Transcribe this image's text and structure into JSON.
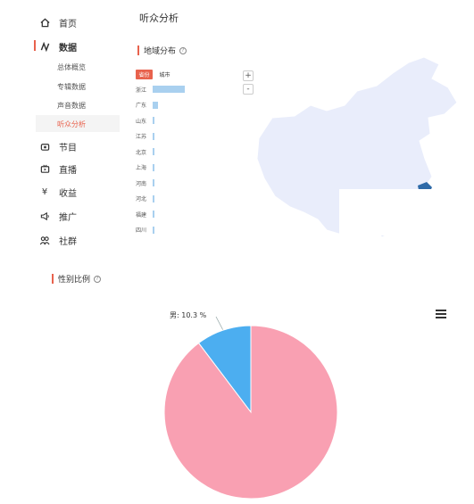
{
  "sidebar": {
    "items": [
      {
        "label": "首页",
        "icon": "home-icon"
      },
      {
        "label": "数据",
        "icon": "data-icon"
      },
      {
        "label": "节目",
        "icon": "program-icon"
      },
      {
        "label": "直播",
        "icon": "live-icon"
      },
      {
        "label": "收益",
        "icon": "income-icon"
      },
      {
        "label": "推广",
        "icon": "promote-icon"
      },
      {
        "label": "社群",
        "icon": "community-icon"
      }
    ],
    "data_sub_items": [
      "总体概览",
      "专辑数据",
      "声音数据",
      "听众分析"
    ],
    "selected_sub_index": 3
  },
  "page_title": "听众分析",
  "region": {
    "section_title": "地域分布",
    "tabs": [
      "省份",
      "城市"
    ],
    "selected_tab": 0,
    "rows": [
      {
        "name": "浙江",
        "share": 1.0
      },
      {
        "name": "广东",
        "share": 0.17
      },
      {
        "name": "山东",
        "share": 0.04
      },
      {
        "name": "江苏",
        "share": 0.04
      },
      {
        "name": "北京",
        "share": 0.04
      },
      {
        "name": "上海",
        "share": 0.04
      },
      {
        "name": "河南",
        "share": 0.03
      },
      {
        "name": "河北",
        "share": 0.03
      },
      {
        "name": "福建",
        "share": 0.03
      },
      {
        "name": "四川",
        "share": 0.03
      }
    ],
    "zoom_in": "+",
    "zoom_out": "-",
    "colors": {
      "tab_active": "#e8624d",
      "bar": "#a9d0ef",
      "map_fill": "#e9edfb",
      "map_highlight": "#2e6aa8"
    }
  },
  "gender": {
    "section_title": "性别比例",
    "label_male": "男: 10.3 %",
    "male_percent": 10.3,
    "female_percent": 89.7,
    "colors": {
      "male": "#4caef0",
      "female": "#f9a0b2"
    }
  },
  "colors": {
    "accent": "#e8624d"
  }
}
